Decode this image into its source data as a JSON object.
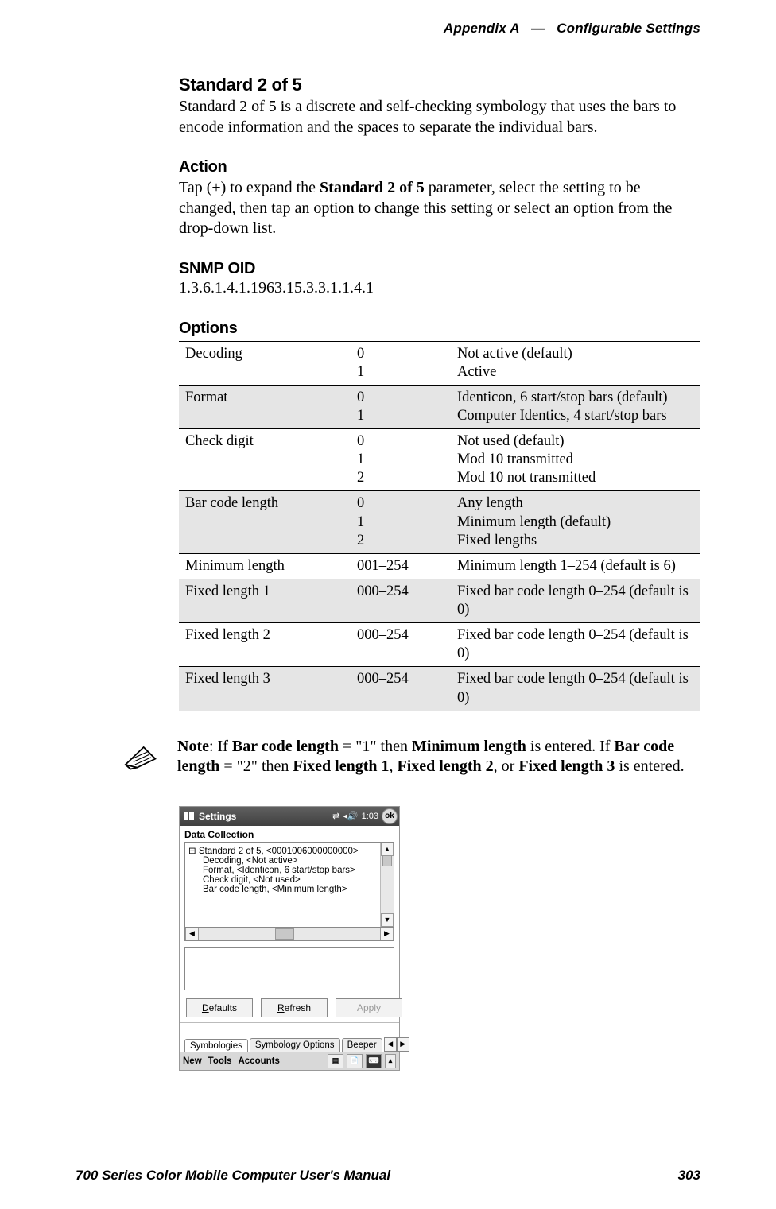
{
  "header": {
    "left": "Appendix A",
    "sep": "—",
    "right": "Configurable Settings"
  },
  "section": {
    "title": "Standard 2 of 5",
    "intro": "Standard 2 of 5 is a discrete and self-checking symbology that uses the bars to encode information and the spaces to separate the individual bars."
  },
  "action": {
    "title": "Action",
    "body_before": "Tap (+) to expand the ",
    "body_bold": "Standard 2 of 5",
    "body_after": " parameter, select the setting to be changed, then tap an option to change this setting or select an option from the drop-down list."
  },
  "snmp": {
    "title": "SNMP OID",
    "value": "1.3.6.1.4.1.1963.15.3.3.1.1.4.1"
  },
  "options": {
    "title": "Options",
    "rows": [
      {
        "name": "Decoding",
        "codes": "0\n1",
        "desc": "Not active (default)\nActive",
        "shaded": false
      },
      {
        "name": "Format",
        "codes": "0\n1",
        "desc": "Identicon, 6 start/stop bars (default)\nComputer Identics, 4 start/stop bars",
        "shaded": true
      },
      {
        "name": "Check digit",
        "codes": "0\n1\n2",
        "desc": "Not used (default)\nMod 10 transmitted\nMod 10 not transmitted",
        "shaded": false
      },
      {
        "name": "Bar code length",
        "codes": "0\n1\n2",
        "desc": "Any length\nMinimum length (default)\nFixed lengths",
        "shaded": true
      },
      {
        "name": "Minimum length",
        "codes": "001–254",
        "desc": "Minimum length 1–254 (default is 6)",
        "shaded": false
      },
      {
        "name": "Fixed length 1",
        "codes": "000–254",
        "desc": "Fixed bar code length 0–254 (default is 0)",
        "shaded": true
      },
      {
        "name": "Fixed length 2",
        "codes": "000–254",
        "desc": "Fixed bar code length 0–254 (default is 0)",
        "shaded": false
      },
      {
        "name": "Fixed length 3",
        "codes": "000–254",
        "desc": "Fixed bar code length 0–254 (default is 0)",
        "shaded": true
      }
    ]
  },
  "note": {
    "prefix": "Note",
    "text_parts": {
      "a": ": If ",
      "b1": "Bar code length",
      "c": " = \"1\" then ",
      "b2": "Minimum length",
      "d": " is entered. If ",
      "b3": "Bar code length",
      "e": " = \"2\" then ",
      "b4": "Fixed length 1",
      "f": ", ",
      "b5": "Fixed length 2",
      "g": ", or ",
      "b6": "Fixed length 3",
      "h": " is entered."
    }
  },
  "screenshot": {
    "title": "Settings",
    "time": "1:03",
    "ok": "ok",
    "panel_title": "Data Collection",
    "tree": {
      "root": "Standard 2 of 5, <0001006000000000>",
      "children": [
        "Decoding, <Not active>",
        "Format, <Identicon, 6 start/stop bars>",
        "Check digit, <Not used>",
        "Bar code length, <Minimum length>"
      ]
    },
    "buttons": {
      "defaults": "Defaults",
      "refresh": "Refresh",
      "apply": "Apply"
    },
    "tabs": {
      "t1": "Symbologies",
      "t2": "Symbology Options",
      "t3": "Beeper"
    },
    "menus": {
      "m1": "New",
      "m2": "Tools",
      "m3": "Accounts"
    }
  },
  "footer": {
    "left": "700 Series Color Mobile Computer User's Manual",
    "right": "303"
  }
}
